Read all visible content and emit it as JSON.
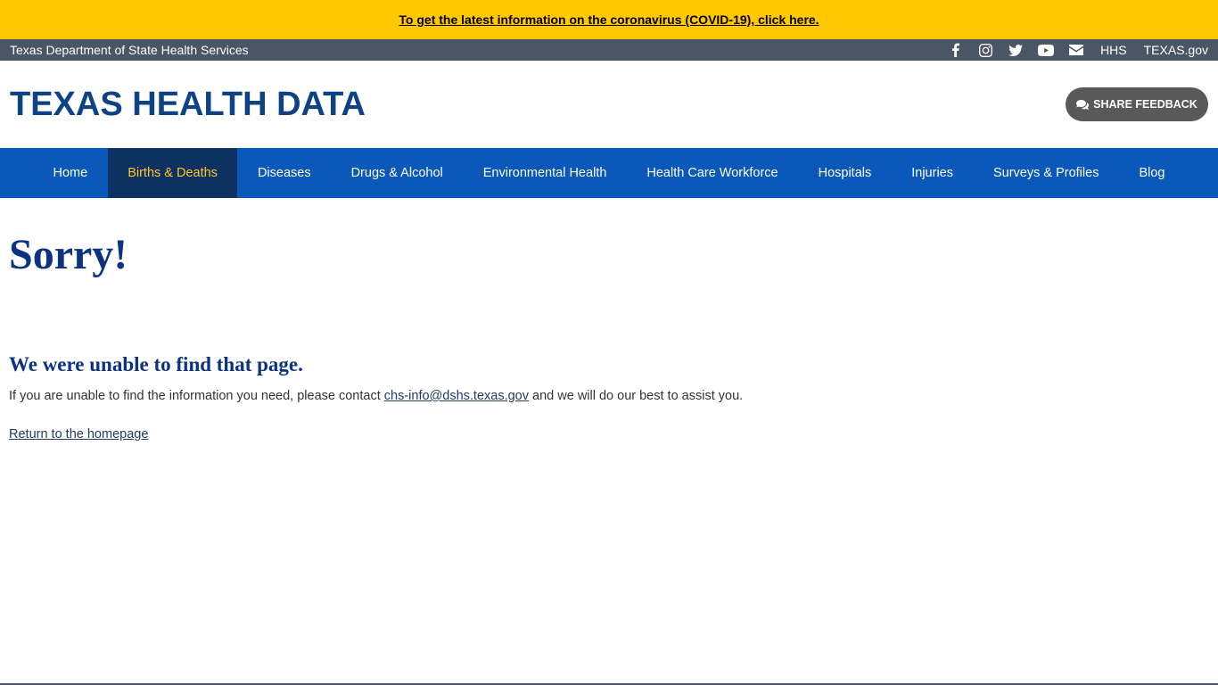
{
  "alert": {
    "text": "To get the latest information on the coronavirus (COVID-19), click here."
  },
  "agency_bar": {
    "agency_name": "Texas Department of State Health Services",
    "social_icons": [
      "facebook-icon",
      "instagram-icon",
      "twitter-icon",
      "youtube-icon",
      "email-icon"
    ],
    "links": [
      "HHS",
      "TEXAS.gov"
    ]
  },
  "header": {
    "site_title": "TEXAS HEALTH DATA",
    "feedback_label": "SHARE FEEDBACK"
  },
  "nav": {
    "items": [
      {
        "label": "Home",
        "active": false
      },
      {
        "label": "Births & Deaths",
        "active": true
      },
      {
        "label": "Diseases",
        "active": false
      },
      {
        "label": "Drugs & Alcohol",
        "active": false
      },
      {
        "label": "Environmental Health",
        "active": false
      },
      {
        "label": "Health Care Workforce",
        "active": false
      },
      {
        "label": "Hospitals",
        "active": false
      },
      {
        "label": "Injuries",
        "active": false
      },
      {
        "label": "Surveys & Profiles",
        "active": false
      },
      {
        "label": "Blog",
        "active": false
      }
    ]
  },
  "content": {
    "heading": "Sorry!",
    "subheading": "We were unable to find that page.",
    "message_before": "If you are unable to find the information you need, please contact ",
    "email": "chs-info@dshs.texas.gov",
    "message_after": " and we will do our best to assist you.",
    "return_link": "Return to the homepage"
  },
  "colors": {
    "alert_bg": "#ffc800",
    "agency_bg": "#4a5566",
    "nav_bg": "#0a58ba",
    "nav_active_bg": "#0d3160",
    "nav_active_text": "#ffc72c",
    "title_color": "#0d4385",
    "heading_color": "#0d3380"
  }
}
